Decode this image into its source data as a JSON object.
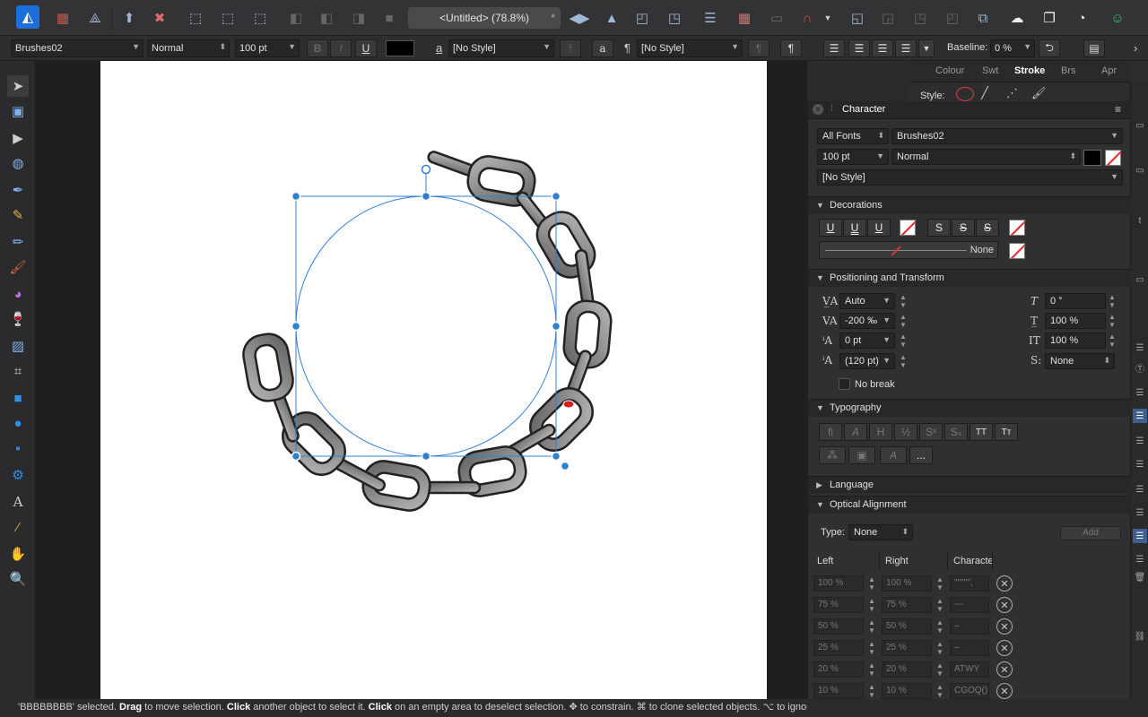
{
  "toolbar": {
    "doc_title": "<Untitled> (78.8%)",
    "star": "*"
  },
  "context": {
    "font_family": "Brushes02",
    "font_style": "Normal",
    "font_size": "100 pt",
    "bold": "B",
    "italic": "I",
    "underline": "U",
    "char_style_icon": "a",
    "char_style": "[No Style]",
    "para_style_icon": "¶",
    "para_style": "[No Style]",
    "baseline_label": "Baseline:",
    "baseline_value": "0 %"
  },
  "studio_tabs": [
    "Colour",
    "Swt",
    "Stroke",
    "Brs",
    "Apr"
  ],
  "stroke": {
    "style_label": "Style:"
  },
  "character": {
    "title": "Character",
    "font_collection": "All Fonts",
    "font_family": "Brushes02",
    "font_size": "100 pt",
    "font_style": "Normal",
    "style": "[No Style]",
    "sections": {
      "decorations": "Decorations",
      "positioning": "Positioning and Transform",
      "typography": "Typography",
      "language": "Language",
      "optical": "Optical Alignment"
    },
    "decorations": {
      "underline_1": "U",
      "underline_2": "U",
      "underline_3": "U",
      "strike_1": "S",
      "strike_2": "S",
      "strike_3": "S",
      "line_none": "None"
    },
    "positioning": {
      "kerning": "Auto",
      "tracking": "-200 ‰",
      "baseline": "0 pt",
      "leading": "(120 pt)",
      "shear": "0 °",
      "vscale": "100 %",
      "hscale": "100 %",
      "position": "None",
      "position_label": "S:",
      "no_break": "No break"
    },
    "typography": {
      "tt": "TT",
      "tr": "Tт",
      "more": "..."
    },
    "optical": {
      "type_label": "Type:",
      "type_value": "None",
      "add": "Add",
      "headers": [
        "Left",
        "Right",
        "Characte"
      ],
      "rows": [
        {
          "left": "100 %",
          "right": "100 %",
          "chars": "\"\"'\"'\","
        },
        {
          "left": "75 %",
          "right": "75 %",
          "chars": "---"
        },
        {
          "left": "50 %",
          "right": "50 %",
          "chars": "–"
        },
        {
          "left": "25 %",
          "right": "25 %",
          "chars": "–"
        },
        {
          "left": "20 %",
          "right": "20 %",
          "chars": "ATWY"
        },
        {
          "left": "10 %",
          "right": "10 %",
          "chars": "CGOQ()"
        }
      ]
    }
  },
  "status": {
    "selected": "'BBBBBBBB' selected.",
    "drag": "Drag",
    "t1": " to move selection. ",
    "click1": "Click",
    "t2": " another object to select it. ",
    "click2": "Click",
    "t3": " on an empty area to deselect selection. ✥ to constrain. ⌘ to clone selected objects. ⌥ to ignore"
  },
  "colors": {
    "accent": "#2f7fd3",
    "chain_fill": "#8c8c8c",
    "panel_bg": "#303032"
  }
}
